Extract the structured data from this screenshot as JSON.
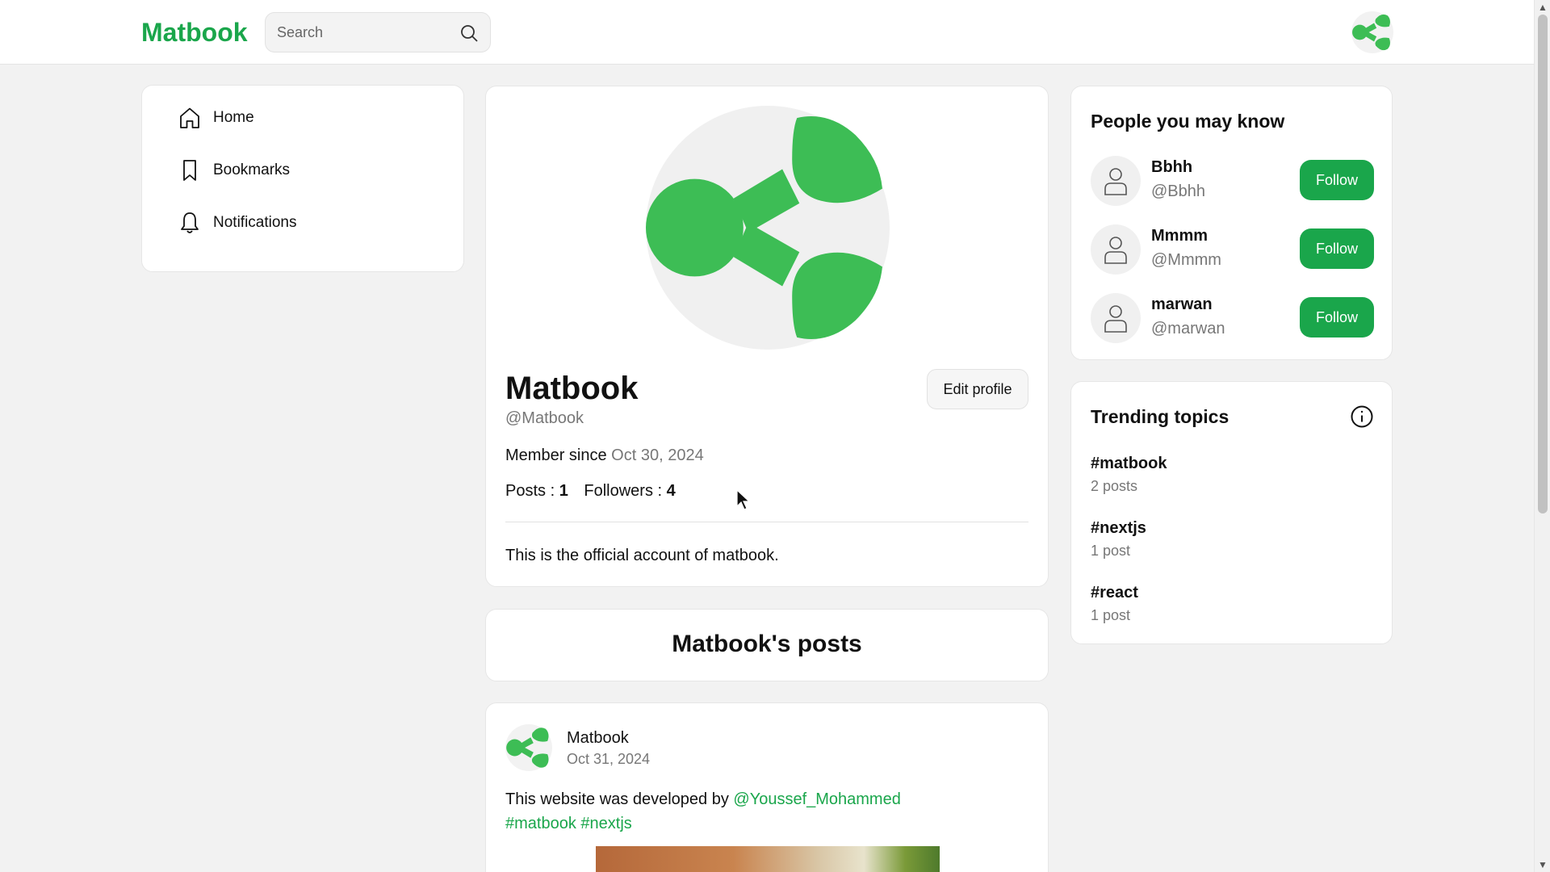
{
  "header": {
    "logo": "Matbook",
    "search_placeholder": "Search"
  },
  "nav": {
    "items": [
      {
        "label": "Home",
        "icon": "home-icon"
      },
      {
        "label": "Bookmarks",
        "icon": "bookmark-icon"
      },
      {
        "label": "Notifications",
        "icon": "bell-icon"
      }
    ]
  },
  "profile": {
    "name": "Matbook",
    "handle": "@Matbook",
    "member_label": "Member since",
    "member_date": "Oct 30, 2024",
    "posts_label": "Posts :",
    "posts_count": "1",
    "followers_label": "Followers :",
    "followers_count": "4",
    "edit_label": "Edit profile",
    "bio": "This is the official account of matbook."
  },
  "posts_section": {
    "title": "Matbook's posts"
  },
  "post": {
    "author": "Matbook",
    "date": "Oct 31, 2024",
    "text": "This website was developed by",
    "mention": "@Youssef_Mohammed",
    "hashtags": [
      "#matbook",
      "#nextjs"
    ]
  },
  "people": {
    "title": "People you may know",
    "follow_label": "Follow",
    "list": [
      {
        "name": "Bbhh",
        "handle": "@Bbhh"
      },
      {
        "name": "Mmmm",
        "handle": "@Mmmm"
      },
      {
        "name": "marwan",
        "handle": "@marwan"
      }
    ]
  },
  "trending": {
    "title": "Trending topics",
    "topics": [
      {
        "tag": "#matbook",
        "count": "2 posts"
      },
      {
        "tag": "#nextjs",
        "count": "1 post"
      },
      {
        "tag": "#react",
        "count": "1 post"
      }
    ]
  },
  "colors": {
    "brand": "#1aa64b",
    "logo_green": "#3dbd55"
  }
}
